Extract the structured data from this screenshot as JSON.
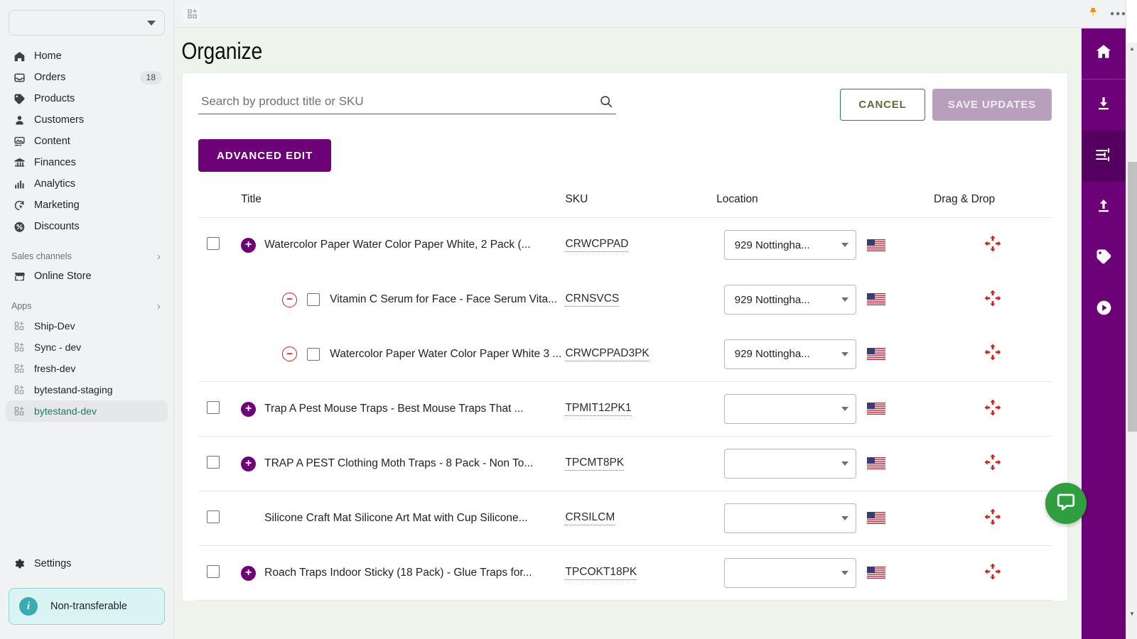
{
  "sidebar": {
    "store_selector": {
      "value": "",
      "icon": "chevron-down-icon"
    },
    "nav": [
      {
        "label": "Home",
        "icon": "home-icon",
        "badge": ""
      },
      {
        "label": "Orders",
        "icon": "orders-inbox-icon",
        "badge": "18"
      },
      {
        "label": "Products",
        "icon": "products-tag-icon",
        "badge": ""
      },
      {
        "label": "Customers",
        "icon": "customers-person-icon",
        "badge": ""
      },
      {
        "label": "Content",
        "icon": "content-image-icon",
        "badge": ""
      },
      {
        "label": "Finances",
        "icon": "finances-bank-icon",
        "badge": ""
      },
      {
        "label": "Analytics",
        "icon": "analytics-bars-icon",
        "badge": ""
      },
      {
        "label": "Marketing",
        "icon": "marketing-cursor-icon",
        "badge": ""
      },
      {
        "label": "Discounts",
        "icon": "discounts-percent-icon",
        "badge": ""
      }
    ],
    "sales_channels": {
      "label": "Sales channels",
      "chevron": "chevron-right-icon",
      "items": [
        {
          "label": "Online Store",
          "icon": "store-icon"
        }
      ]
    },
    "apps": {
      "label": "Apps",
      "chevron": "chevron-right-icon",
      "items": [
        {
          "label": "Ship-Dev",
          "icon": "app-icon",
          "active": false
        },
        {
          "label": "Sync - dev",
          "icon": "app-icon",
          "active": false
        },
        {
          "label": "fresh-dev",
          "icon": "app-icon",
          "active": false
        },
        {
          "label": "bytestand-staging",
          "icon": "app-icon",
          "active": false
        },
        {
          "label": "bytestand-dev",
          "icon": "app-icon",
          "active": true
        }
      ]
    },
    "settings": {
      "label": "Settings",
      "icon": "gear-icon"
    },
    "notice": {
      "label": "Non-transferable",
      "icon": "info-icon",
      "color": "#3aabb0"
    }
  },
  "topbar": {
    "apps_grid_icon": "apps-add-grid-icon",
    "pin_icon": "pin-icon",
    "pin_color": "#e8920f",
    "more_icon": "more-horizontal-icon"
  },
  "page": {
    "title": "Organize"
  },
  "search": {
    "value": "",
    "placeholder": "Search by product title or SKU",
    "icon": "search-icon"
  },
  "actions": {
    "cancel_label": "CANCEL",
    "save_label": "SAVE UPDATES",
    "advanced_edit_label": "ADVANCED EDIT",
    "primary_color": "#6d0177",
    "cancel_border_color": "#2f7d4f",
    "save_disabled_color": "#b8a0bd"
  },
  "table": {
    "columns": [
      "",
      "Title",
      "SKU",
      "Location",
      "",
      "Drag & Drop"
    ],
    "headers": {
      "title": "Title",
      "sku": "SKU",
      "location": "Location",
      "dragdrop": "Drag & Drop"
    },
    "rows": [
      {
        "level": 0,
        "expander": "plus",
        "checked": false,
        "title": "Watercolor Paper Water Color Paper White, 2 Pack (...",
        "sku": "CRWCPPAD",
        "location": "929 Nottingha...",
        "flag": "us-flag-icon",
        "drag": "move-arrows-icon"
      },
      {
        "level": 1,
        "expander": "minus",
        "checked": false,
        "title": "Vitamin C Serum for Face - Face Serum Vita...",
        "sku": "CRNSVCS",
        "location": "929 Nottingha...",
        "flag": "us-flag-icon",
        "drag": "move-arrows-icon"
      },
      {
        "level": 1,
        "expander": "minus",
        "checked": false,
        "title": "Watercolor Paper Water Color Paper White 3 ...",
        "sku": "CRWCPPAD3PK",
        "location": "929 Nottingha...",
        "flag": "us-flag-icon",
        "drag": "move-arrows-icon"
      },
      {
        "level": 0,
        "expander": "plus",
        "checked": false,
        "title": "Trap A Pest Mouse Traps - Best Mouse Traps That ...",
        "sku": "TPMIT12PK1",
        "location": "",
        "flag": "us-flag-icon",
        "drag": "move-arrows-icon"
      },
      {
        "level": 0,
        "expander": "plus",
        "checked": false,
        "title": "TRAP A PEST Clothing Moth Traps - 8 Pack - Non To...",
        "sku": "TPCMT8PK",
        "location": "",
        "flag": "us-flag-icon",
        "drag": "move-arrows-icon"
      },
      {
        "level": 0,
        "expander": "none",
        "checked": false,
        "title": "Silicone Craft Mat Silicone Art Mat with Cup Silicone...",
        "sku": "CRSILCM",
        "location": "",
        "flag": "us-flag-icon",
        "drag": "move-arrows-icon"
      },
      {
        "level": 0,
        "expander": "plus",
        "checked": false,
        "title": "Roach Traps Indoor Sticky (18 Pack) - Glue Traps for...",
        "sku": "TPCOKT18PK",
        "location": "",
        "flag": "us-flag-icon",
        "drag": "move-arrows-icon"
      }
    ]
  },
  "rail": {
    "background": "#6d0177",
    "items": [
      {
        "icon": "home-icon",
        "active": false
      },
      {
        "icon": "download-icon",
        "active": false
      },
      {
        "icon": "sliders-settings-icon",
        "active": true
      },
      {
        "icon": "upload-icon",
        "active": false
      },
      {
        "icon": "tag-icon",
        "active": false
      },
      {
        "icon": "play-circle-icon",
        "active": false
      }
    ]
  },
  "chat": {
    "icon": "chat-bubble-icon",
    "color": "#2e9e3e"
  }
}
